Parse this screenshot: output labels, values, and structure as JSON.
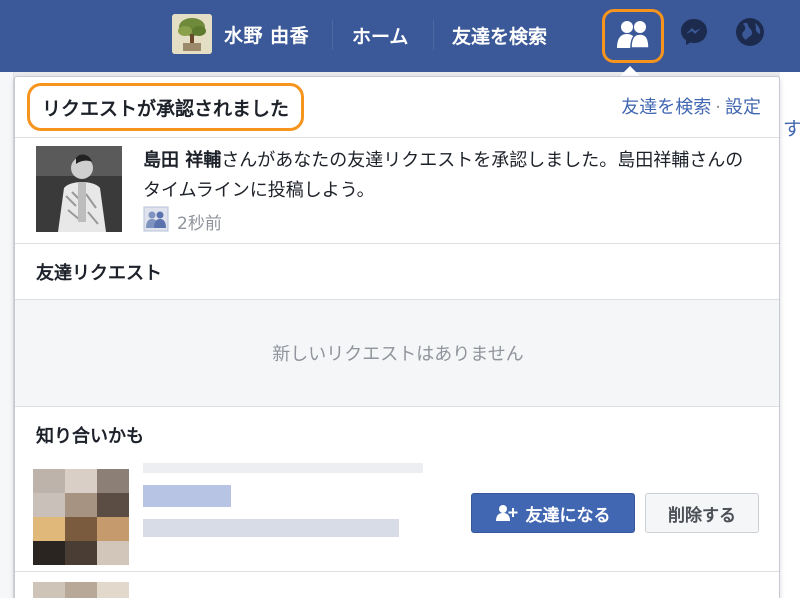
{
  "topbar": {
    "user_name": "水野 由香",
    "nav_home": "ホーム",
    "nav_find_friends": "友達を検索",
    "icons": [
      "friend-requests-icon",
      "messenger-icon",
      "globe-notifications-icon"
    ]
  },
  "background": {
    "right_edge_text": "す"
  },
  "panel": {
    "header_title": "リクエストが承認されました",
    "header_link_find": "友達を検索",
    "header_link_sep": "·",
    "header_link_settings": "設定",
    "notification": {
      "name": "島田 祥輔",
      "text": "さんがあなたの友達リクエストを承認しました。島田祥輔さんのタイムラインに投稿しよう。",
      "time": "2秒前"
    },
    "friend_requests_title": "友達リクエスト",
    "no_requests_text": "新しいリクエストはありません",
    "pymk_title": "知り合いかも",
    "pymk_add_label": "友達になる",
    "pymk_remove_label": "削除する"
  },
  "colors": {
    "brand_blue": "#3b5998",
    "highlight_orange": "#f7941d",
    "link_blue": "#4267b2"
  }
}
